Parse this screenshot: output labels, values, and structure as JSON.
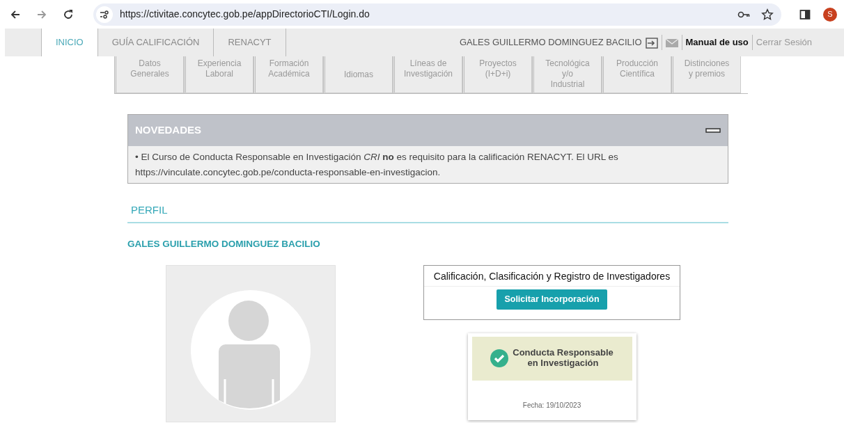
{
  "browser": {
    "url": "https://ctivitae.concytec.gob.pe/appDirectorioCTI/Login.do",
    "profile_initial": "S"
  },
  "nav": {
    "tabs": [
      {
        "label": "INICIO",
        "selected": true
      },
      {
        "label": "GUÍA CALIFICACIÓN",
        "selected": false
      },
      {
        "label": "RENACYT",
        "selected": false
      }
    ],
    "user": "GALES GUILLERMO DOMINGUEZ BACILIO",
    "manual": "Manual de uso",
    "logout": "Cerrar Sesión"
  },
  "sections": [
    {
      "lines": [
        "Datos",
        "Generales"
      ]
    },
    {
      "lines": [
        "Experiencia",
        "Laboral"
      ]
    },
    {
      "lines": [
        "Formación",
        "Académica"
      ]
    },
    {
      "lines": [
        "Idiomas"
      ]
    },
    {
      "lines": [
        "Líneas de",
        "Investigación"
      ]
    },
    {
      "lines": [
        "Proyectos",
        "(I+D+i)"
      ]
    },
    {
      "lines": [
        "Tecnológica",
        "y/o",
        "Industrial"
      ]
    },
    {
      "lines": [
        "Producción",
        "Científica"
      ]
    },
    {
      "lines": [
        "Distinciones",
        "y premios"
      ]
    }
  ],
  "news": {
    "title": "NOVEDADES",
    "expanded": true,
    "items": [
      "• El Curso de Conducta Responsable en Investigación *CRI* **no** es requisito para la calificación RENACYT. El URL es https://vinculate.concytec.gob.pe/conducta-responsable-en-investigacion."
    ]
  },
  "profile": {
    "heading": "PERFIL",
    "name": "GALES GUILLERMO DOMINGUEZ BACILIO",
    "registration": {
      "title": "Calificación, Clasificación y Registro de Investigadores",
      "button": "Solicitar Incorporación"
    },
    "certificate": {
      "lines": [
        "Conducta Responsable",
        "en Investigación"
      ],
      "date": "Fecha: 19/10/2023"
    }
  }
}
